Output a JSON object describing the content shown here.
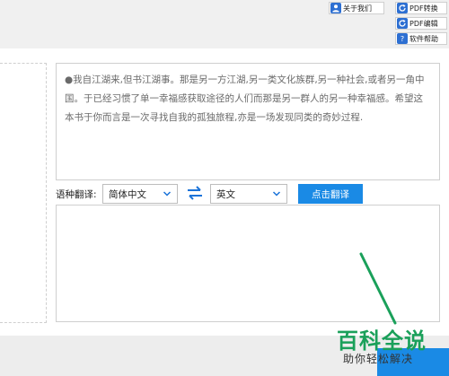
{
  "header": {
    "about": "关于我们",
    "pdf_convert": "PDF转换",
    "pdf_edit": "PDF编辑",
    "help": "软件帮助",
    "help_icon_text": "?"
  },
  "source": {
    "text": "●我自江湖来,但书江湖事。那是另一方江湖,另一类文化族群,另一种社会,或者另一角中国。于已经习惯了单一幸福感获取途径的人们而那是另一群人的另一种幸福感。希望这本书于你而言是一次寻找自我的孤独旅程,亦是一场发现同类的奇妙过程."
  },
  "translation": {
    "label": "语种翻译:",
    "source_lang": "简体中文",
    "target_lang": "英文",
    "translate_button": "点击翻译",
    "output": ""
  },
  "watermark": {
    "title": "百科全说",
    "subtitle": "助你轻松解决"
  },
  "colors": {
    "accent": "#1a8ae5",
    "watermark_green": "#1aa05a"
  }
}
